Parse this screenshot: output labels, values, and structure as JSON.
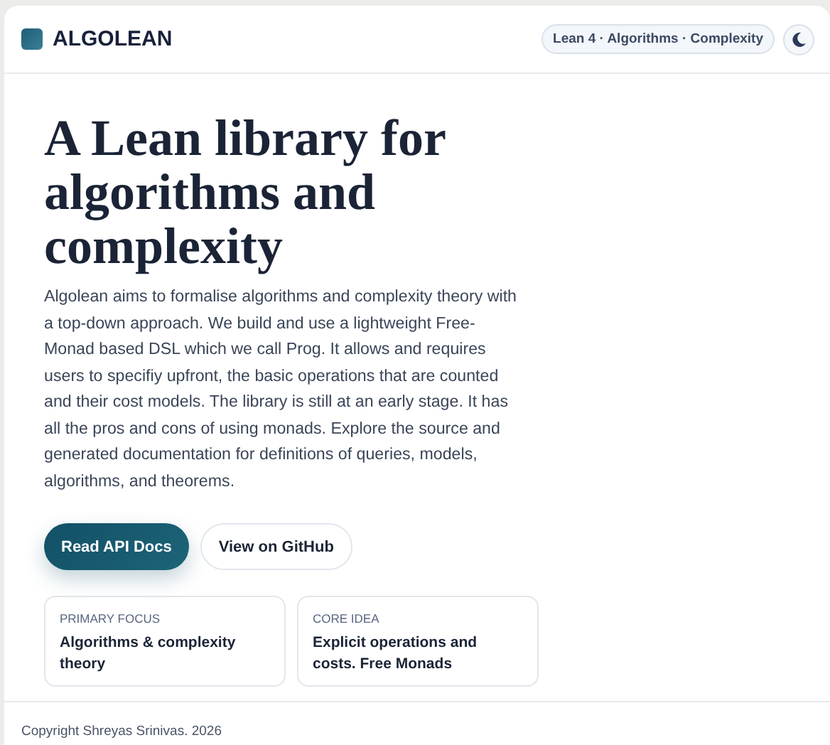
{
  "brand": {
    "name": "ALGOLEAN"
  },
  "header": {
    "tagline": "Lean 4 · Algorithms · Complexity"
  },
  "hero": {
    "title": "A Lean library for algorithms and complexity",
    "description": "Algolean aims to formalise algorithms and complexity theory with a top-down approach. We build and use a lightweight Free-Monad based DSL which we call Prog. It allows and requires users to specifiy upfront, the basic operations that are counted and their cost models. The library is still at an early stage. It has all the pros and cons of using monads. Explore the source and generated documentation for definitions of queries, models, algorithms, and theorems.",
    "buttons": [
      {
        "label": "Read API Docs",
        "kind": "primary"
      },
      {
        "label": "View on GitHub",
        "kind": "secondary"
      }
    ],
    "cards": [
      {
        "label": "PRIMARY FOCUS",
        "value": "Algorithms & complexity theory"
      },
      {
        "label": "CORE IDEA",
        "value": "Explicit operations and costs. Free Monads"
      }
    ]
  },
  "footer": {
    "text": "Copyright Shreyas Srinivas. 2026"
  }
}
